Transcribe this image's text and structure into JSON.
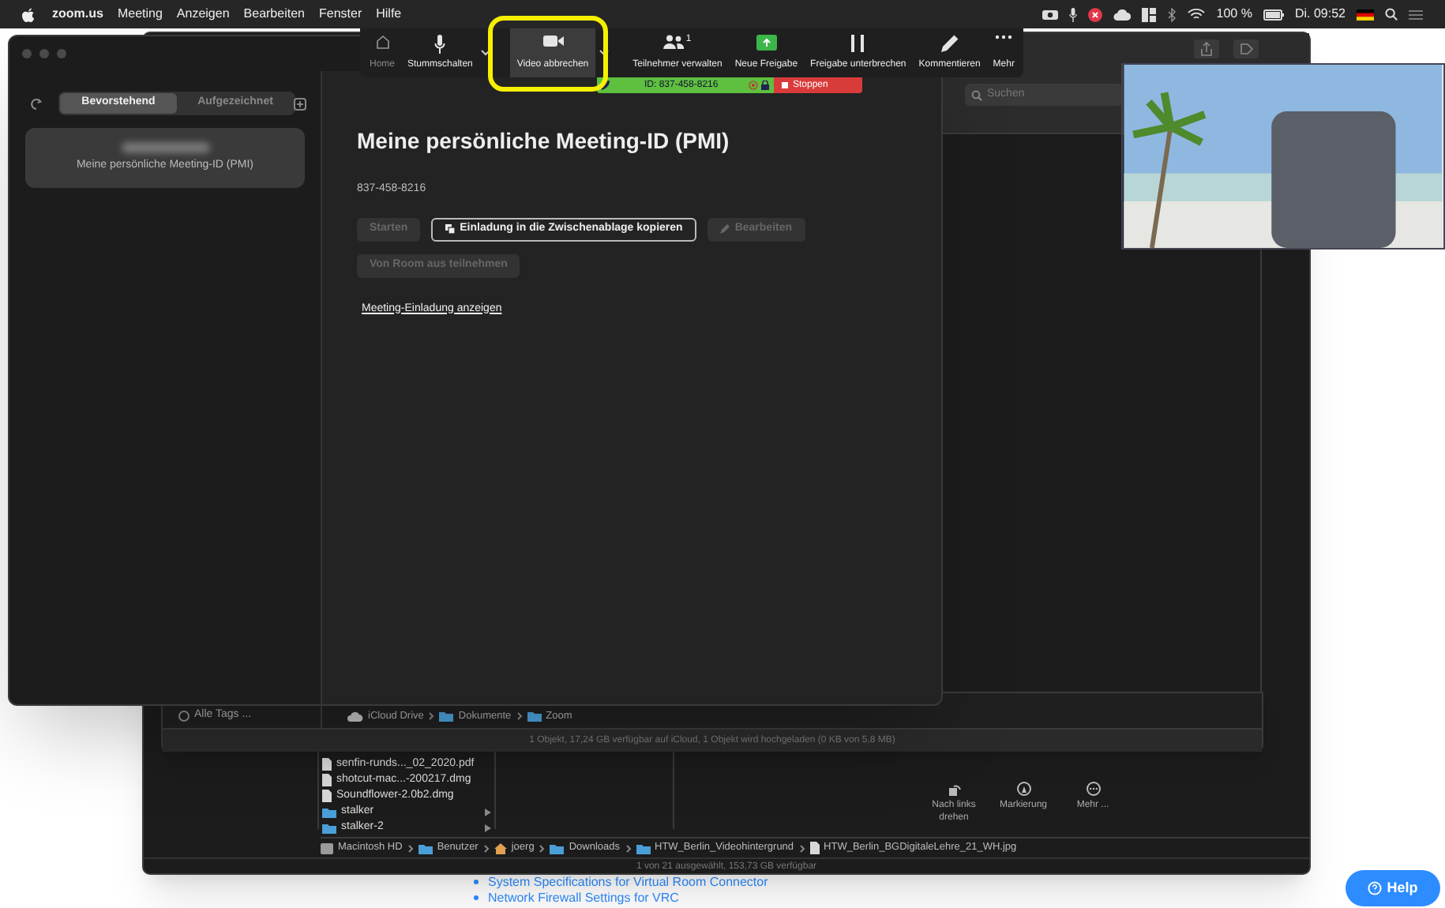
{
  "menu_bar": {
    "app": "zoom.us",
    "menus": [
      "Meeting",
      "Anzeigen",
      "Bearbeiten",
      "Fenster",
      "Hilfe"
    ],
    "battery": "100 %",
    "clock": "Di. 09:52"
  },
  "meeting_toolbar": {
    "items": [
      {
        "kind": "home",
        "label": "Home",
        "highlighted": false,
        "caret": false
      },
      {
        "kind": "mic",
        "label": "Stummschalten",
        "highlighted": false,
        "caret": true
      },
      {
        "kind": "video",
        "label": "Video abbrechen",
        "highlighted": true,
        "caret": true
      },
      {
        "kind": "people",
        "label": "Teilnehmer verwalten",
        "badge": "1",
        "highlighted": false,
        "caret": false
      },
      {
        "kind": "share",
        "label": "Neue Freigabe",
        "highlighted": false,
        "caret": false
      },
      {
        "kind": "pause",
        "label": "Freigabe unterbrechen",
        "highlighted": false,
        "caret": false
      },
      {
        "kind": "pen",
        "label": "Kommentieren",
        "highlighted": false,
        "caret": false
      },
      {
        "kind": "dots",
        "label": "Mehr",
        "highlighted": false,
        "caret": false
      }
    ],
    "meeting_id": "ID: 837-458-8216",
    "stop": "Stoppen"
  },
  "zoom_window": {
    "tabs": [
      {
        "label": "Bevorstehend",
        "selected": true
      },
      {
        "label": "Aufgezeichnet",
        "selected": false
      }
    ],
    "meetings": [
      {
        "title": "Meine persönliche Meeting-ID (PMI)",
        "selected": true
      }
    ],
    "detail": {
      "title": "Meine persönliche Meeting-ID (PMI)",
      "meeting_id": "837-458-8216",
      "buttons": [
        {
          "label": "Starten",
          "kind": "plain",
          "disabled": true
        },
        {
          "label": "Einladung in die Zwischenablage kopieren",
          "kind": "copy",
          "disabled": false
        },
        {
          "label": "Bearbeiten",
          "kind": "edit",
          "disabled": true
        },
        {
          "label": "Von Room aus teilnehmen",
          "kind": "plain",
          "disabled": true
        }
      ],
      "link": "Meeting-Einladung anzeigen"
    }
  },
  "finder": {
    "search_placeholder": "Suchen",
    "sidebar_item": "Alle Tags ...",
    "files": [
      {
        "name": "senfin-runds..._02_2020.pdf",
        "kind": "file"
      },
      {
        "name": "shotcut-mac...-200217.dmg",
        "kind": "file"
      },
      {
        "name": "Soundflower-2.0b2.dmg",
        "kind": "file"
      },
      {
        "name": "stalker",
        "kind": "folder"
      },
      {
        "name": "stalker-2",
        "kind": "folder"
      }
    ],
    "actions": [
      {
        "kind": "rotate",
        "label": "Nach links drehen"
      },
      {
        "kind": "markup",
        "label": "Markierung"
      },
      {
        "kind": "more",
        "label": "Mehr ..."
      }
    ],
    "path": [
      {
        "label": "Macintosh HD",
        "kind": "disk"
      },
      {
        "label": "Benutzer",
        "kind": "folder"
      },
      {
        "label": "joerg",
        "kind": "home"
      },
      {
        "label": "Downloads",
        "kind": "folder"
      },
      {
        "label": "HTW_Berlin_Videohintergrund",
        "kind": "folder"
      },
      {
        "label": "HTW_Berlin_BGDigitaleLehre_21_WH.jpg",
        "kind": "file"
      }
    ],
    "status": "1 von 21 ausgewählt, 153,73 GB verfügbar"
  },
  "icloud_window": {
    "path": [
      {
        "label": "iCloud Drive",
        "kind": "cloud"
      },
      {
        "label": "Dokumente",
        "kind": "folder"
      },
      {
        "label": "Zoom",
        "kind": "folder"
      }
    ],
    "status": "1 Objekt, 17,24 GB verfügbar auf iCloud, 1 Objekt wird hochgeladen (0 KB von 5,8 MB)"
  },
  "web_page": {
    "links": [
      "System Specifications for Virtual Room Connector",
      "Network Firewall Settings for VRC"
    ],
    "help": "Help"
  }
}
